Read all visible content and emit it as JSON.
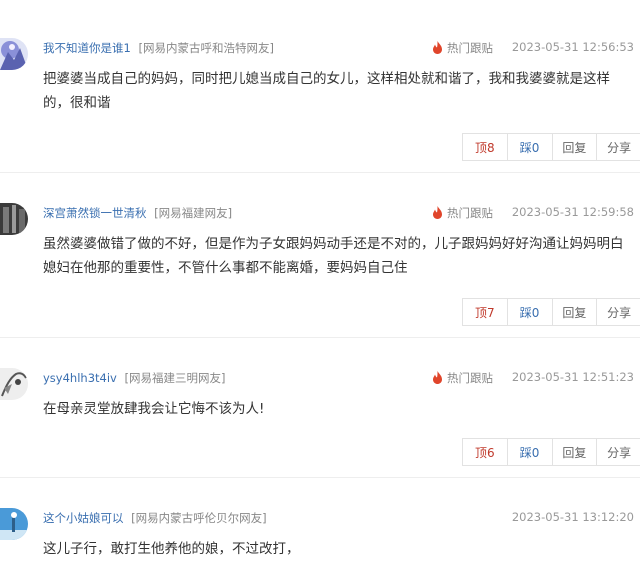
{
  "comments": [
    {
      "username": "我不知道你是谁1",
      "location": "[网易内蒙古呼和浩特网友]",
      "hot_label": "热门跟贴",
      "time": "2023-05-31 12:56:53",
      "text": "把婆婆当成自己的妈妈，同时把儿媳当成自己的女儿，这样相处就和谐了，我和我婆婆就是这样的，很和谐",
      "up": "顶8",
      "down": "踩0",
      "reply": "回复",
      "share": "分享",
      "avatar_color": "#6a6fb8"
    },
    {
      "username": "深宫萧然锁一世清秋",
      "location": "[网易福建网友]",
      "hot_label": "热门跟贴",
      "time": "2023-05-31 12:59:58",
      "text": "虽然婆婆做错了做的不好，但是作为子女跟妈妈动手还是不对的，儿子跟妈妈好好沟通让妈妈明白媳妇在他那的重要性，不管什么事都不能离婚，要妈妈自己住",
      "up": "顶7",
      "down": "踩0",
      "reply": "回复",
      "share": "分享",
      "avatar_color": "#4a4a4a"
    },
    {
      "username": "ysy4hlh3t4iv",
      "location": "[网易福建三明网友]",
      "hot_label": "热门跟贴",
      "time": "2023-05-31 12:51:23",
      "text": "在母亲灵堂放肆我会让它悔不该为人!",
      "up": "顶6",
      "down": "踩0",
      "reply": "回复",
      "share": "分享",
      "avatar_color": "#dddddd"
    },
    {
      "username": "这个小姑娘可以",
      "location": "[网易内蒙古呼伦贝尔网友]",
      "hot_label": "",
      "time": "2023-05-31 13:12:20",
      "text": "这儿子行，敢打生他养他的娘，不过改打，",
      "avatar_color": "#4a9ad8"
    }
  ],
  "colors": {
    "username": "#3a6fb0",
    "hot_icon": "#e0452b",
    "up": "#c0392b"
  }
}
